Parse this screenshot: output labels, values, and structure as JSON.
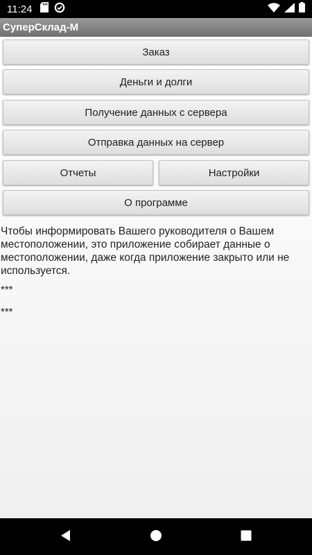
{
  "status_bar": {
    "time": "11:24",
    "left_icons": [
      "sd-card-icon",
      "data-saver-icon"
    ],
    "right_icons": [
      "wifi-icon",
      "cell-signal-icon",
      "battery-icon"
    ]
  },
  "app": {
    "title": "СуперСклад-М"
  },
  "buttons": {
    "order": "Заказ",
    "money_debts": "Деньги и долги",
    "receive_data": "Получение данных с сервера",
    "send_data": "Отправка данных на сервер",
    "reports": "Отчеты",
    "settings": "Настройки",
    "about": "О программе"
  },
  "info": {
    "location_notice": "Чтобы информировать Вашего руководителя о Вашем местоположении, это приложение собирает данные о местоположении, даже когда приложение закрыто или не используется.",
    "line1": "***",
    "line2": "***"
  },
  "nav_bar": {
    "icons": [
      "back-icon",
      "home-icon",
      "recents-icon"
    ]
  },
  "colors": {
    "status_bar": "#000000",
    "title_bar": "#808080",
    "button": "#e6e6e6",
    "text": "#222222"
  }
}
